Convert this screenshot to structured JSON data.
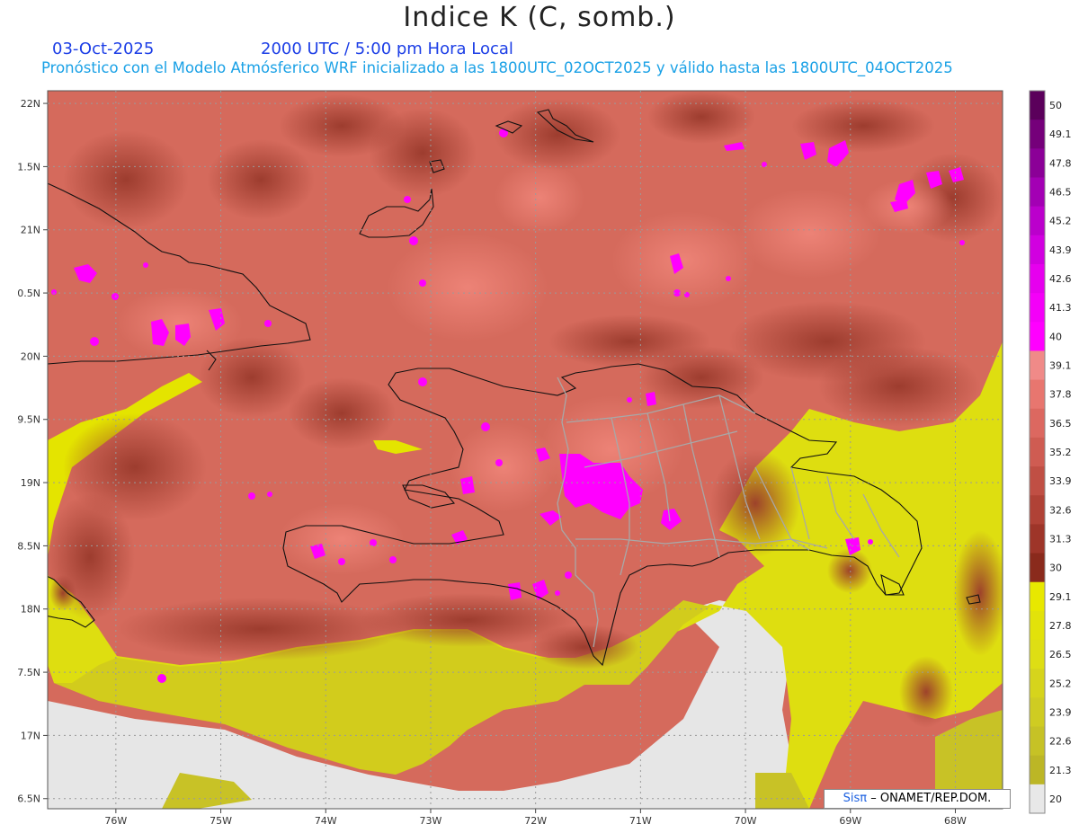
{
  "header": {
    "title": "Indice K (C, somb.)",
    "date": "03-Oct-2025",
    "time": "2000 UTC / 5:00 pm Hora Local",
    "subtitle": "Pronóstico con el Modelo Atmósferico WRF inicializado a las 1800UTC_02OCT2025 y válido hasta las  1800UTC_04OCT2025"
  },
  "map": {
    "lon_range": [
      -76.65,
      -67.55
    ],
    "lat_range": [
      16.42,
      22.1
    ],
    "lon_ticks": [
      "76W",
      "75W",
      "74W",
      "73W",
      "72W",
      "71W",
      "70W",
      "69W",
      "68W"
    ],
    "lat_ticks": [
      "22N",
      "1.5N",
      "21N",
      "0.5N",
      "20N",
      "9.5N",
      "19N",
      "8.5N",
      "18N",
      "7.5N",
      "17N",
      "6.5N"
    ],
    "grid": "dotted"
  },
  "colorbar": {
    "labels": [
      "50",
      "49.1",
      "47.8",
      "46.5",
      "45.2",
      "43.9",
      "42.6",
      "41.3",
      "40",
      "39.1",
      "37.8",
      "36.5",
      "35.2",
      "33.9",
      "32.6",
      "31.3",
      "30",
      "29.1",
      "27.8",
      "26.5",
      "25.2",
      "23.9",
      "22.6",
      "21.3",
      "20"
    ],
    "colors": [
      "#5b005b",
      "#75007a",
      "#8b0097",
      "#a300b4",
      "#bb00cc",
      "#d100e0",
      "#e600ee",
      "#f400f8",
      "#ff00ff",
      "#f08a88",
      "#e8766f",
      "#dc6860",
      "#cf5c52",
      "#c04f44",
      "#b04236",
      "#9e3529",
      "#8a2a1c",
      "#e8e800",
      "#e2e20a",
      "#dede14",
      "#d6d41c",
      "#cfcc22",
      "#c6c226",
      "#bcb626",
      "#e8e8e8"
    ]
  },
  "credit": {
    "logo": "Sisπ",
    "text": "– ONAMET/REP.DOM."
  }
}
